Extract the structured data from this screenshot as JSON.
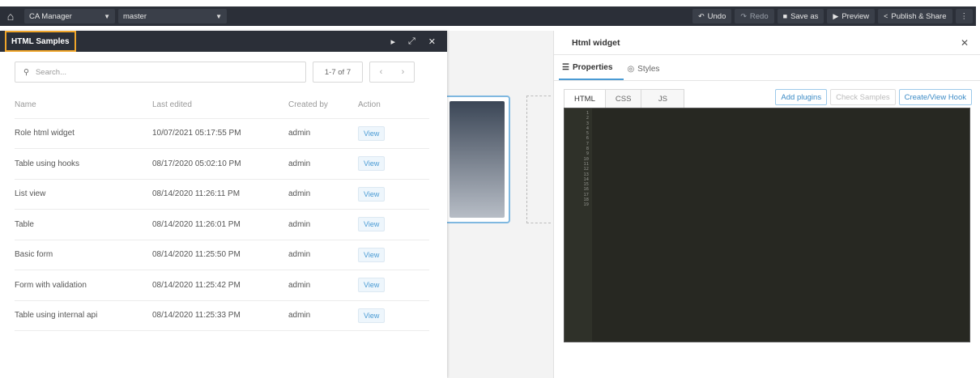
{
  "topbar": {
    "app_select": "CA Manager",
    "branch_select": "master",
    "buttons": {
      "undo": "Undo",
      "redo": "Redo",
      "save_as": "Save as",
      "preview": "Preview",
      "publish": "Publish & Share"
    }
  },
  "samples_panel": {
    "title": "HTML Samples",
    "search_placeholder": "Search...",
    "pager": "1-7 of 7",
    "columns": [
      "Name",
      "Last edited",
      "Created by",
      "Action"
    ],
    "rows": [
      {
        "name": "Role html widget",
        "edited": "10/07/2021 05:17:55 PM",
        "by": "admin",
        "action": "View"
      },
      {
        "name": "Table using hooks",
        "edited": "08/17/2020 05:02:10 PM",
        "by": "admin",
        "action": "View"
      },
      {
        "name": "List view",
        "edited": "08/14/2020 11:26:11 PM",
        "by": "admin",
        "action": "View"
      },
      {
        "name": "Table",
        "edited": "08/14/2020 11:26:01 PM",
        "by": "admin",
        "action": "View"
      },
      {
        "name": "Basic form",
        "edited": "08/14/2020 11:25:50 PM",
        "by": "admin",
        "action": "View"
      },
      {
        "name": "Form with validation",
        "edited": "08/14/2020 11:25:42 PM",
        "by": "admin",
        "action": "View"
      },
      {
        "name": "Table using internal api",
        "edited": "08/14/2020 11:25:33 PM",
        "by": "admin",
        "action": "View"
      }
    ]
  },
  "widget_panel": {
    "title": "Html widget",
    "tabs": [
      "Properties",
      "Styles"
    ],
    "code_tabs": [
      "HTML",
      "CSS",
      "JS"
    ],
    "buttons": {
      "add_plugins": "Add plugins",
      "check_samples": "Check Samples",
      "create_hook": "Create/View Hook"
    },
    "line_numbers": "1\n2\n3\n4\n5\n6\n7\n8\n9\n10\n11\n12\n13\n14\n15\n16\n17\n18\n19"
  },
  "colors": {
    "toolbar_bg": "#2b2f38",
    "accent": "#4a9bd4",
    "highlight_border": "#f0a52a",
    "editor_bg": "#272822"
  }
}
